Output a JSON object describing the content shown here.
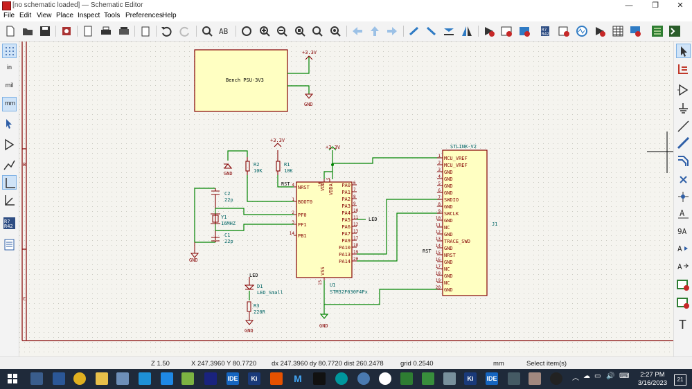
{
  "window": {
    "title": "[no schematic loaded] — Schematic Editor",
    "minimize": "—",
    "maximize": "❐",
    "close": "✕"
  },
  "menu": [
    "File",
    "Edit",
    "View",
    "Place",
    "Inspect",
    "Tools",
    "Preferences",
    "Help"
  ],
  "left_toolbar": {
    "units_in": "in",
    "units_mil": "mil",
    "units_mm": "mm"
  },
  "schematic": {
    "border_rows": [
      "B",
      "C"
    ],
    "psu": {
      "label": "Bench PSU-3V3",
      "power": "+3.3V",
      "gnd": "GND"
    },
    "power_3v3": "+3.3V",
    "gnd": "GND",
    "r2": {
      "ref": "R2",
      "value": "10K"
    },
    "r1": {
      "ref": "R1",
      "value": "10K"
    },
    "c2": {
      "ref": "C2",
      "value": "22p"
    },
    "c1": {
      "ref": "C1",
      "value": "22p"
    },
    "y1": {
      "ref": "Y1",
      "value": "16MHZ"
    },
    "d1": {
      "ref": "D1",
      "value": "LED_Small",
      "net": "LED"
    },
    "r3": {
      "ref": "R3",
      "value": "220R"
    },
    "u1": {
      "ref": "U1",
      "value": "STM32F030F4Px",
      "left_pins": [
        {
          "num": "4",
          "name": "NRST"
        },
        {
          "num": "1",
          "name": "BOOT0"
        },
        {
          "num": "2",
          "name": "PF0"
        },
        {
          "num": "3",
          "name": "PF1"
        },
        {
          "num": "14",
          "name": "PB1"
        }
      ],
      "top_pins": [
        {
          "num": "16",
          "name": "VDD"
        },
        {
          "num": "5",
          "name": "VDDA"
        }
      ],
      "bottom_pin": {
        "num": "15",
        "name": "VSS"
      },
      "right_pins": [
        {
          "num": "6",
          "name": "PA0"
        },
        {
          "num": "7",
          "name": "PA1"
        },
        {
          "num": "8",
          "name": "PA2"
        },
        {
          "num": "9",
          "name": "PA3"
        },
        {
          "num": "10",
          "name": "PA4"
        },
        {
          "num": "11",
          "name": "PA5"
        },
        {
          "num": "12",
          "name": "PA6"
        },
        {
          "num": "13",
          "name": "PA7"
        },
        {
          "num": "17",
          "name": "PA9"
        },
        {
          "num": "18",
          "name": "PA10"
        },
        {
          "num": "19",
          "name": "PA13"
        },
        {
          "num": "20",
          "name": "PA14"
        }
      ],
      "rst_label": "RST",
      "led_label": "LED"
    },
    "j1": {
      "ref": "J1",
      "value": "STLINK-V2",
      "rst_label": "RST",
      "pins": [
        {
          "num": "1",
          "name": "MCU_VREF"
        },
        {
          "num": "2",
          "name": "MCU_VREF"
        },
        {
          "num": "3",
          "name": "GND"
        },
        {
          "num": "4",
          "name": "GND"
        },
        {
          "num": "5",
          "name": "GND"
        },
        {
          "num": "6",
          "name": "GND"
        },
        {
          "num": "7",
          "name": "SWDIO"
        },
        {
          "num": "8",
          "name": "GND"
        },
        {
          "num": "9",
          "name": "SWCLK"
        },
        {
          "num": "10",
          "name": "GND"
        },
        {
          "num": "11",
          "name": "NC"
        },
        {
          "num": "12",
          "name": "GND"
        },
        {
          "num": "13",
          "name": "TRACE_SWD"
        },
        {
          "num": "14",
          "name": "GND"
        },
        {
          "num": "15",
          "name": "NRST"
        },
        {
          "num": "16",
          "name": "GND"
        },
        {
          "num": "17",
          "name": "NC"
        },
        {
          "num": "18",
          "name": "GND"
        },
        {
          "num": "19",
          "name": "NC"
        },
        {
          "num": "20",
          "name": "GND"
        }
      ]
    }
  },
  "status": {
    "zoom": "Z 1.50",
    "coords": "X 247.3960  Y 80.7720",
    "delta": "dx 247.3960  dy 80.7720  dist 260.2478",
    "grid": "grid 0.2540",
    "units": "mm",
    "mode": "Select item(s)"
  },
  "taskbar": {
    "time": "2:27 PM",
    "date": "3/16/2023",
    "notif": "21",
    "apps": [
      "IDE",
      "Ki",
      "M",
      "Ki",
      "IDE"
    ]
  },
  "colors": {
    "wire": "#008400",
    "component": "#840000",
    "body_fill": "#ffffc2",
    "pin_text": "#840000",
    "ref_text": "#006464",
    "value_text": "#006464",
    "label_text": "#000000"
  }
}
